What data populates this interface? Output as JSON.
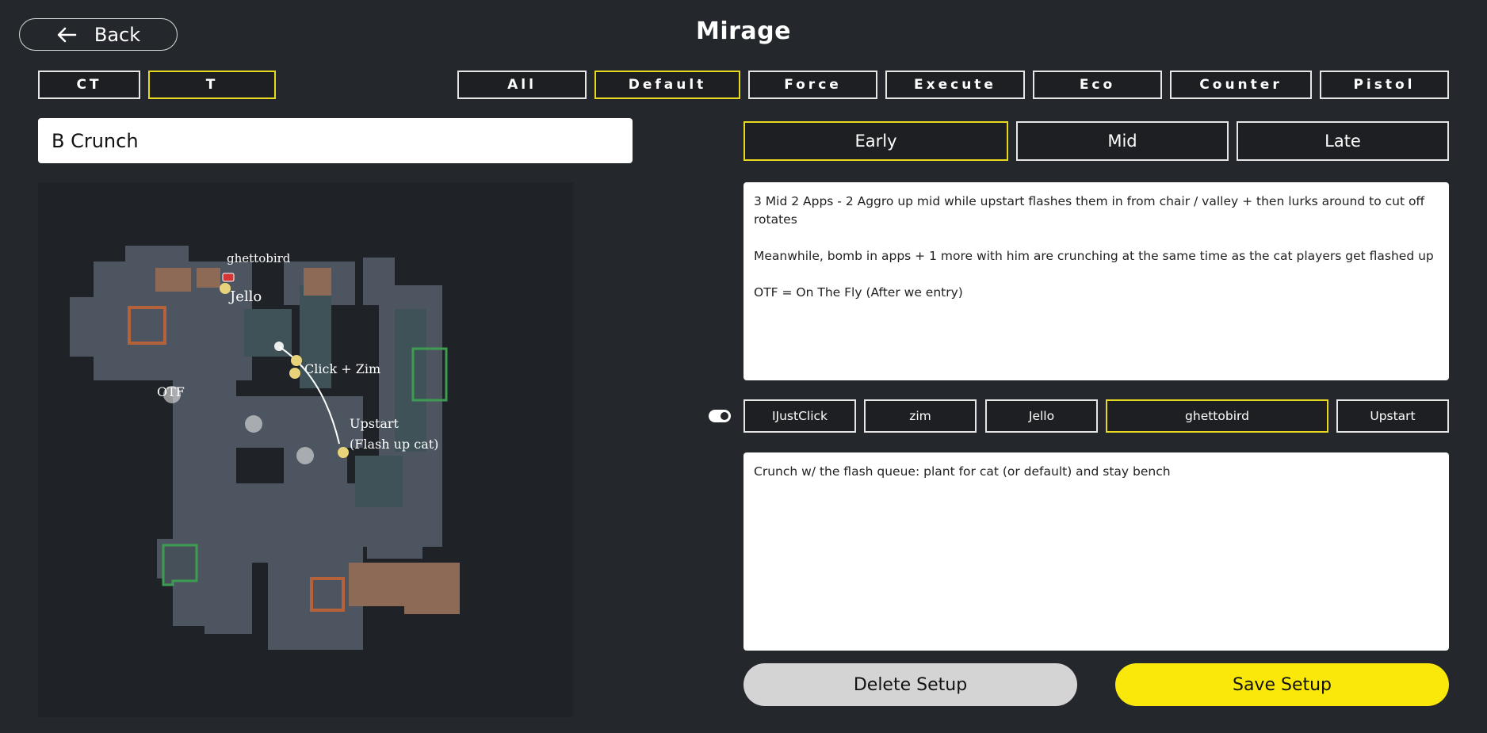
{
  "header": {
    "back_label": "Back",
    "title": "Mirage"
  },
  "sides": [
    {
      "label": "CT",
      "active": false
    },
    {
      "label": "T",
      "active": true
    }
  ],
  "categories": [
    {
      "label": "All",
      "active": false
    },
    {
      "label": "Default",
      "active": true
    },
    {
      "label": "Force",
      "active": false
    },
    {
      "label": "Execute",
      "active": false
    },
    {
      "label": "Eco",
      "active": false
    },
    {
      "label": "Counter",
      "active": false
    },
    {
      "label": "Pistol",
      "active": false
    }
  ],
  "setup_name": "B Crunch",
  "phases": [
    {
      "label": "Early",
      "active": true
    },
    {
      "label": "Mid",
      "active": false
    },
    {
      "label": "Late",
      "active": false
    }
  ],
  "general_notes": "3 Mid 2 Apps - 2 Aggro up mid while upstart flashes them in from chair / valley + then lurks around to cut off rotates\n\nMeanwhile, bomb in apps + 1 more with him are crunching at the same time as the cat players get flashed up\n\nOTF = On The Fly (After we entry)",
  "players": [
    {
      "label": "IJustClick",
      "active": false
    },
    {
      "label": "zim",
      "active": false
    },
    {
      "label": "Jello",
      "active": false
    },
    {
      "label": "ghettobird",
      "active": true
    },
    {
      "label": "Upstart",
      "active": false
    }
  ],
  "player_notes": "Crunch w/ the flash queue: plant for cat (or default) and stay bench",
  "map_labels": {
    "ghettobird": "ghettobird",
    "jello": "Jello",
    "click_zim": "Click + Zim",
    "otf": "OTF",
    "upstart_line1": "Upstart",
    "upstart_line2": "(Flash up cat)"
  },
  "actions": {
    "delete_label": "Delete Setup",
    "save_label": "Save Setup"
  },
  "colors": {
    "accent_yellow": "#fbe80b",
    "active_border": "#e8d920",
    "background": "#24272b"
  }
}
